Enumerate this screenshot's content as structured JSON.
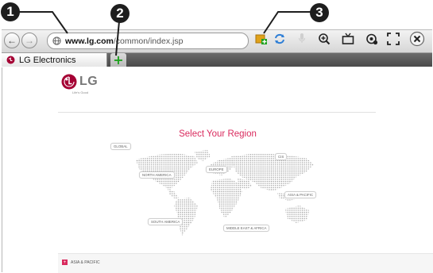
{
  "callouts": [
    "1",
    "2",
    "3"
  ],
  "browser": {
    "address": {
      "host": "www.lg.com",
      "path": "/common/index.jsp"
    },
    "tab": {
      "title": "LG Electronics"
    },
    "add_tab_symbol": "+",
    "tools": [
      "bookmark-add-icon",
      "sync-icon",
      "microphone-icon",
      "zoom-in-icon",
      "tv-icon",
      "settings-icon",
      "fullscreen-icon",
      "close-icon"
    ]
  },
  "page": {
    "logo": {
      "text": "LG",
      "tagline": "Life's Good"
    },
    "title": "Select Your Region",
    "regions": {
      "global": "GLOBAL",
      "north_america": "NORTH AMERICA",
      "europe": "EUROPE",
      "cis": "CIS",
      "asia_pacific": "ASIA & PACIFIC",
      "south_america": "SOUTH AMERICA",
      "middle_east_africa": "MIDDLE EAST & AFRICA"
    },
    "selected_region": {
      "badge": "+",
      "label": "ASIA & PACIFIC"
    }
  },
  "colors": {
    "accent": "#d92b5e",
    "logo_red": "#a50034",
    "add_tab_green": "#1ea21e"
  }
}
